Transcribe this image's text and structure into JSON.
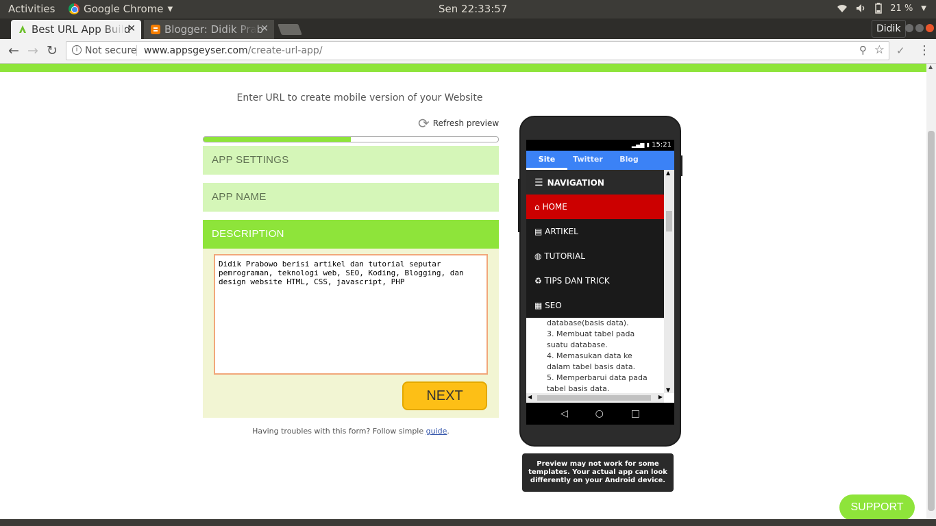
{
  "system": {
    "activities": "Activities",
    "app_name": "Google Chrome",
    "clock": "Sen 22:33:57",
    "battery": "21 %"
  },
  "browser": {
    "tabs": [
      {
        "label": "Best URL App Build",
        "active": true
      },
      {
        "label": "Blogger: Didik Prab",
        "active": false
      }
    ],
    "profile": "Didik",
    "security_label": "Not secure",
    "url_host": "www.appsgeyser.com",
    "url_path": "/create-url-app/"
  },
  "page": {
    "headline": "Enter URL to create mobile version of your Website",
    "refresh_label": "Refresh preview",
    "progress_percent": 50,
    "sections": {
      "app_settings": "APP SETTINGS",
      "app_name": "APP NAME",
      "description": "DESCRIPTION"
    },
    "description_value": "Didik Prabowo berisi artikel dan tutorial seputar pemrograman, teknologi web, SEO, Koding, Blogging, dan design website HTML, CSS, javascript, PHP",
    "next_label": "NEXT",
    "help_text": "Having troubles with this form? Follow simple ",
    "help_link": "guide",
    "help_end": "."
  },
  "preview": {
    "status_time": "15:21",
    "tabs": [
      "Site",
      "Twitter",
      "Blog"
    ],
    "nav_header": "NAVIGATION",
    "nav_items": [
      "HOME",
      "ARTIKEL",
      "TUTORIAL",
      "TIPS DAN TRICK",
      "SEO"
    ],
    "content_lines": [
      "database(basis data).",
      "3. Membuat tabel pada suatu database.",
      "4. Memasukan data ke dalam tabel basis data.",
      "5. Memperbarui data pada tabel basis data."
    ],
    "note": "Preview may not work for some templates. Your actual app can look differently on your Android device."
  },
  "support_label": "SUPPORT",
  "colors": {
    "brand_green": "#8ee43a",
    "next_yellow": "#fdbf16",
    "nav_active_red": "#cc0000",
    "preview_tab_blue": "#3b82f6"
  }
}
